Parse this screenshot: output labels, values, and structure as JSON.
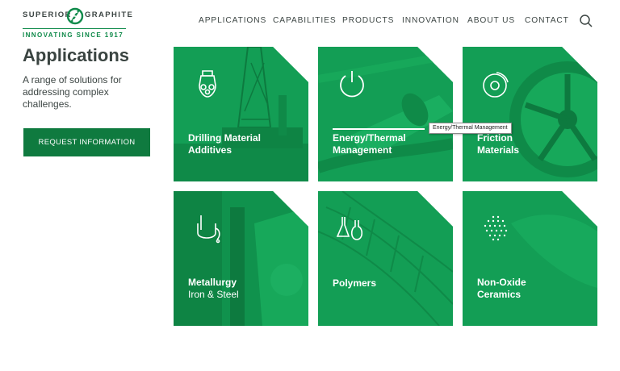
{
  "brand": {
    "word1": "SUPERIOR",
    "word2": "GRAPHITE",
    "tagline": "INNOVATING SINCE 1917",
    "color": "#0f8a4a"
  },
  "nav": {
    "items": [
      "APPLICATIONS",
      "CAPABILITIES",
      "PRODUCTS",
      "INNOVATION",
      "ABOUT US",
      "CONTACT"
    ],
    "search_icon": "search-icon"
  },
  "intro": {
    "title": "Applications",
    "description": "A range of solutions for addressing complex challenges.",
    "button_label": "REQUEST INFORMATION"
  },
  "tiles": [
    {
      "line1": "Drilling Material",
      "line2": "Additives",
      "icon": "drill-bit-icon"
    },
    {
      "line1": "Energy/Thermal",
      "line2": "Management",
      "icon": "power-icon"
    },
    {
      "line1": "Friction",
      "line2": "Materials",
      "icon": "brake-disc-icon"
    },
    {
      "line1": "Metallurgy",
      "line2": "Iron & Steel",
      "icon": "ladle-icon"
    },
    {
      "line1": "Polymers",
      "line2": "",
      "icon": "flask-icon"
    },
    {
      "line1": "Non-Oxide",
      "line2": "Ceramics",
      "icon": "dot-sphere-icon"
    }
  ],
  "tooltip": "Energy/Thermal Management",
  "colors": {
    "tile": "#139e55",
    "button": "#0f7a3f",
    "text": "#3d4644"
  }
}
